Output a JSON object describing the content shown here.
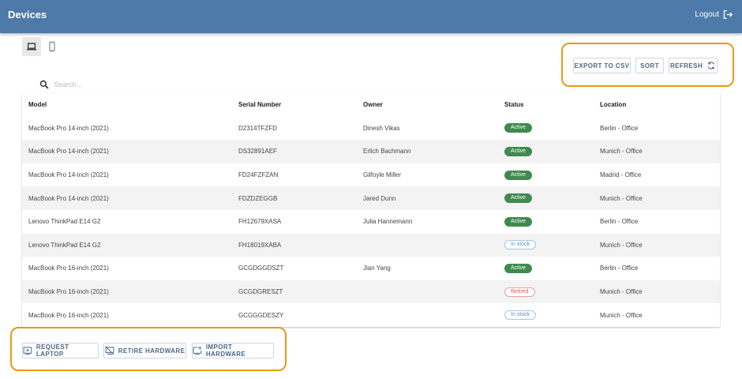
{
  "header": {
    "title": "Devices",
    "logout_label": "Logout"
  },
  "view_toggle": {
    "laptop_icon": "laptop-icon",
    "phone_icon": "phone-icon",
    "selected": "laptop"
  },
  "search": {
    "placeholder": "Search...",
    "value": ""
  },
  "toolbar": {
    "export_label": "EXPORT TO CSV",
    "sort_label": "SORT",
    "refresh_label": "REFRESH"
  },
  "table": {
    "columns": [
      "Model",
      "Serial Number",
      "Owner",
      "Status",
      "Location"
    ],
    "rows": [
      {
        "model": "MacBook Pro 14-inch (2021)",
        "serial": "D2314TFZFD",
        "owner": "Dinesh Vikas",
        "status": "Active",
        "location": "Berlin - Office"
      },
      {
        "model": "MacBook Pro 14-inch (2021)",
        "serial": "DS32891AEF",
        "owner": "Erlich Bachmann",
        "status": "Active",
        "location": "Munich - Office"
      },
      {
        "model": "MacBook Pro 14-inch (2021)",
        "serial": "FD24FZFZAN",
        "owner": "Gilfoyle Miller",
        "status": "Active",
        "location": "Madrid - Office"
      },
      {
        "model": "MacBook Pro 14-inch (2021)",
        "serial": "FDZDZEGGB",
        "owner": "Jared Dunn",
        "status": "Active",
        "location": "Munich - Office"
      },
      {
        "model": "Lenovo ThinkPad E14 G2",
        "serial": "FH12679XASA",
        "owner": "Julia Hannemann",
        "status": "Active",
        "location": "Berlin - Office"
      },
      {
        "model": "Lenovo ThinkPad E14 G2",
        "serial": "FH18019XABA",
        "owner": "",
        "status": "In stock",
        "location": "Munich - Office"
      },
      {
        "model": "MacBook Pro 16-inch (2021)",
        "serial": "GCGDGGDSZT",
        "owner": "Jian Yang",
        "status": "Active",
        "location": "Berlin - Office"
      },
      {
        "model": "MacBook Pro 16-inch (2021)",
        "serial": "GCGDGRESZT",
        "owner": "",
        "status": "Retired",
        "location": "Munich - Office"
      },
      {
        "model": "MacBook Pro 16-inch (2021)",
        "serial": "GCGGGDESZY",
        "owner": "",
        "status": "In stock",
        "location": "Munich - Office"
      }
    ]
  },
  "actions": {
    "request_label": "REQUEST LAPTOP",
    "retire_label": "RETIRE HARDWARE",
    "import_label": "IMPORT HARDWARE"
  },
  "colors": {
    "header_bg": "#4d7aa8",
    "active": "#3f8a4f",
    "in_stock": "#5b8fc0",
    "retired": "#cc5a5a",
    "highlight": "#e69a17",
    "button_text": "#4b6783"
  }
}
